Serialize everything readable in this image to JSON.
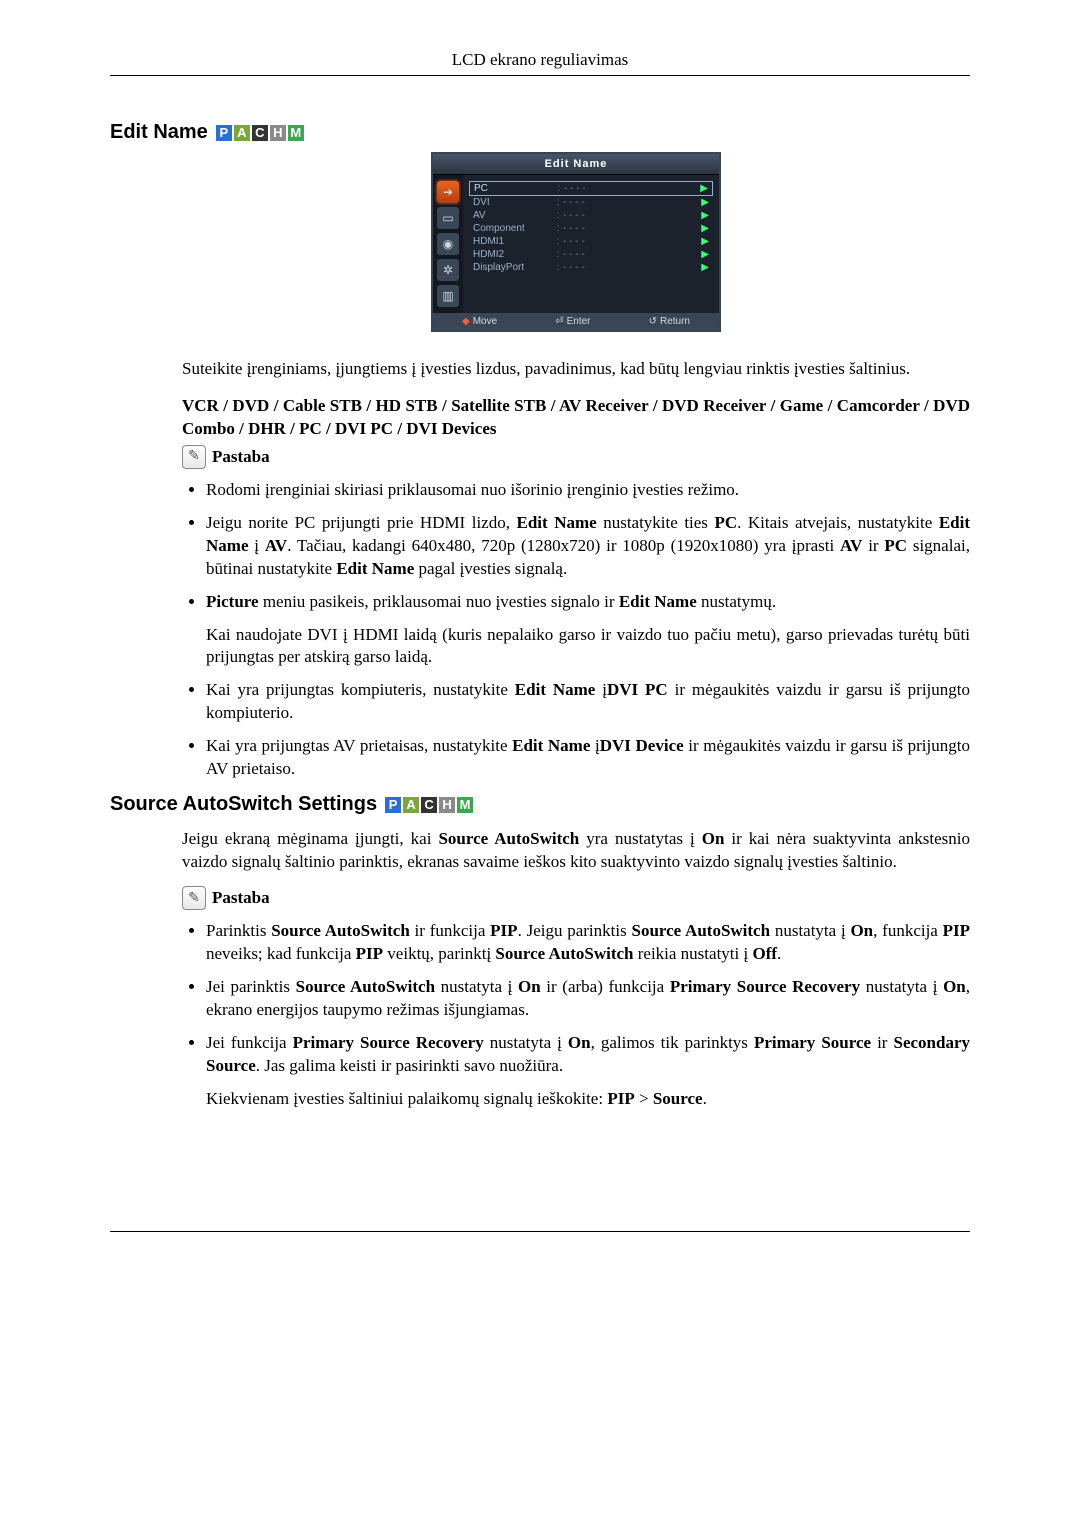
{
  "header": {
    "title": "LCD ekrano reguliavimas"
  },
  "badges": {
    "P": {
      "bg": "#2a6fd6"
    },
    "A": {
      "bg": "#7aa63a"
    },
    "C": {
      "bg": "#333333"
    },
    "H": {
      "bg": "#8a8a8a"
    },
    "M": {
      "bg": "#39a84e"
    }
  },
  "section1": {
    "title": "Edit Name",
    "osd": {
      "title": "Edit Name",
      "items": [
        {
          "label": "PC",
          "value": "- - - -",
          "selected": true
        },
        {
          "label": "DVI",
          "value": "- - - -"
        },
        {
          "label": "AV",
          "value": "- - - -"
        },
        {
          "label": "Component",
          "value": "- - - -"
        },
        {
          "label": "HDMI1",
          "value": "- - - -"
        },
        {
          "label": "HDMI2",
          "value": "- - - -"
        },
        {
          "label": "DisplayPort",
          "value": "- - - -"
        }
      ],
      "footer": {
        "move": "Move",
        "enter": "Enter",
        "return": "Return"
      }
    },
    "intro": "Suteikite įrenginiams, įjungtiems į įvesties lizdus, pavadinimus, kad būtų lengviau rinktis įvesties šaltinius.",
    "options": "VCR / DVD / Cable STB / HD STB / Satellite STB / AV Receiver / DVD Receiver / Game / Camcorder / DVD Combo / DHR / PC / DVI PC / DVI Devices",
    "note_label": "Pastaba",
    "bullets": {
      "b1": "Rodomi įrenginiai skiriasi priklausomai nuo išorinio įrenginio įvesties režimo.",
      "b2": {
        "t1": "Jeigu norite PC prijungti prie HDMI lizdo, ",
        "bold1": "Edit Name",
        "t2": " nustatykite ties ",
        "bold2": "PC",
        "t3": ". Kitais atvejais, nustatykite ",
        "bold3": "Edit Name",
        "t4": " į ",
        "bold4": "AV",
        "t5": ". Tačiau, kadangi 640x480, 720p (1280x720) ir 1080p (1920x1080) yra įprasti ",
        "bold5": "AV",
        "t6": " ir ",
        "bold6": "PC",
        "t7": " signalai, būtinai nustatykite ",
        "bold7": "Edit Name",
        "t8": " pagal įvesties signalą."
      },
      "b3": {
        "bold1": "Picture",
        "t1": " meniu pasikeis, priklausomai nuo įvesties signalo ir ",
        "bold2": "Edit Name",
        "t2": " nustatymų.",
        "sub": "Kai naudojate DVI į HDMI laidą (kuris nepalaiko garso ir vaizdo tuo pačiu metu), garso prievadas turėtų būti prijungtas per atskirą garso laidą."
      },
      "b4": {
        "t1": "Kai yra prijungtas kompiuteris, nustatykite  ",
        "bold1": "Edit Name",
        "t2": "  į",
        "bold2": "DVI PC",
        "t3": " ir mėgaukitės vaizdu ir garsu iš prijungto kompiuterio."
      },
      "b5": {
        "t1": "Kai yra prijungtas AV prietaisas, nustatykite  ",
        "bold1": "Edit Name",
        "t2": "  į",
        "bold2": "DVI Device",
        "t3": " ir mėgaukitės vaizdu ir garsu iš prijungto AV prietaiso."
      }
    }
  },
  "section2": {
    "title": "Source AutoSwitch Settings",
    "intro": {
      "t1": "Jeigu ekraną mėginama įjungti, kai ",
      "b1": "Source AutoSwitch",
      "t2": " yra nustatytas į ",
      "b2": "On",
      "t3": " ir kai nėra suaktyvinta ankstesnio vaizdo signalų šaltinio parinktis, ekranas savaime ieškos kito suaktyvinto vaizdo signalų įvesties šaltinio."
    },
    "note_label": "Pastaba",
    "bullets": {
      "b1": {
        "t1": "Parinktis ",
        "b1": "Source AutoSwitch",
        "t2": " ir funkcija ",
        "b2": "PIP",
        "t3": ". Jeigu parinktis ",
        "b3": "Source AutoSwitch",
        "t4": " nustatyta į ",
        "b4": "On",
        "t5": ", funkcija ",
        "b5": "PIP",
        "t6": " neveiks; kad funkcija ",
        "b6": "PIP",
        "t7": " veiktų, parinktį ",
        "b7": "Source AutoSwitch",
        "t8": " reikia nustatyti į ",
        "b8": "Off",
        "t9": "."
      },
      "b2": {
        "t1": "Jei parinktis ",
        "b1": "Source AutoSwitch",
        "t2": " nustatyta į ",
        "b2": "On",
        "t3": " ir (arba) funkcija ",
        "b3": "Primary Source Recovery",
        "t4": " nustatyta į ",
        "b4": "On",
        "t5": ", ekrano energijos taupymo režimas išjungiamas."
      },
      "b3": {
        "t1": "Jei funkcija ",
        "b1": "Primary Source Recovery",
        "t2": " nustatyta į ",
        "b2": "On",
        "t3": ", galimos tik parinktys ",
        "b3": "Primary Source",
        "t4": " ir ",
        "b4": "Secondary Source",
        "t5": ". Jas galima keisti ir pasirinkti savo nuožiūra.",
        "sub_t1": "Kiekvienam įvesties šaltiniui palaikomų signalų ieškokite: ",
        "sub_b1": "PIP",
        "sub_t2": " > ",
        "sub_b2": "Source",
        "sub_t3": "."
      }
    }
  }
}
